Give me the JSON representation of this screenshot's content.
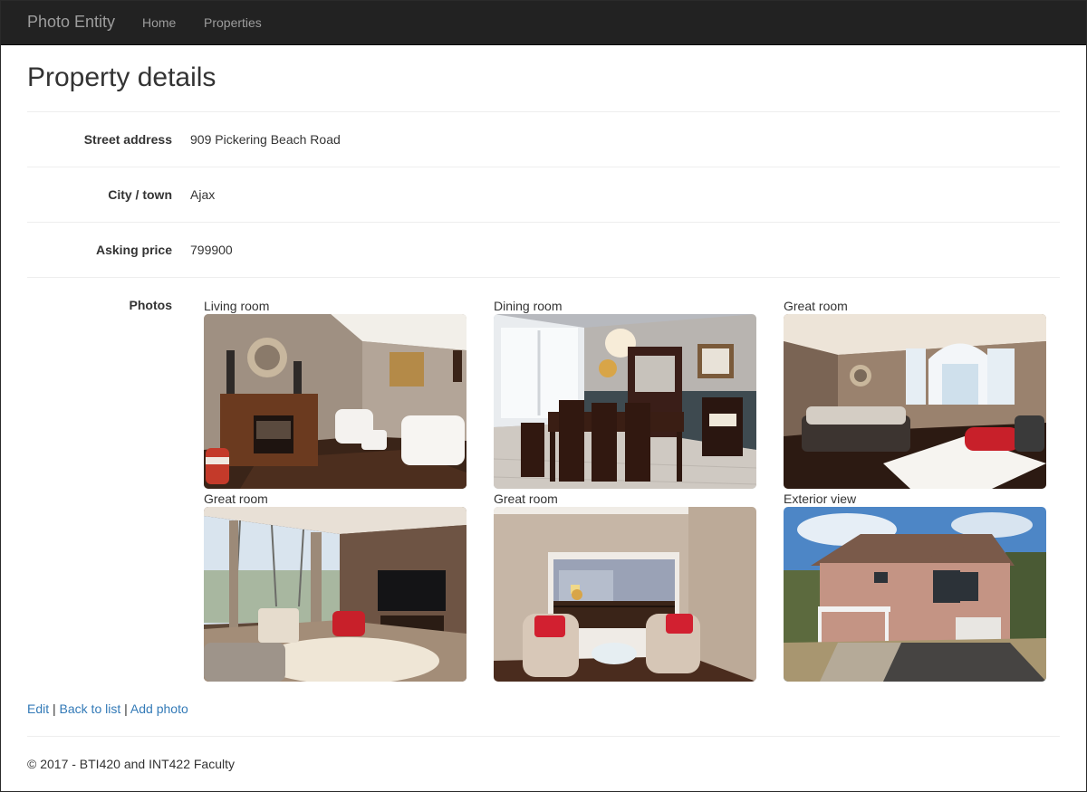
{
  "navbar": {
    "brand": "Photo Entity",
    "links": [
      "Home",
      "Properties"
    ]
  },
  "page": {
    "title": "Property details"
  },
  "details": [
    {
      "label": "Street address",
      "value": "909 Pickering Beach Road"
    },
    {
      "label": "City / town",
      "value": "Ajax"
    },
    {
      "label": "Asking price",
      "value": "799900"
    }
  ],
  "photos": {
    "label": "Photos",
    "items": [
      {
        "caption": "Living room",
        "icon": "living-room-photo"
      },
      {
        "caption": "Dining room",
        "icon": "dining-room-photo"
      },
      {
        "caption": "Great room",
        "icon": "great-room-photo"
      },
      {
        "caption": "Great room",
        "icon": "great-room-photo"
      },
      {
        "caption": "Great room",
        "icon": "great-room-photo"
      },
      {
        "caption": "Exterior view",
        "icon": "exterior-view-photo"
      }
    ]
  },
  "actions": {
    "edit": "Edit",
    "back": "Back to list",
    "add_photo": "Add photo",
    "separator": "|"
  },
  "footer": {
    "text": "© 2017 - BTI420 and INT422 Faculty"
  },
  "colors": {
    "navbar_bg": "#222222",
    "navbar_text": "#9d9d9d",
    "link": "#337ab7",
    "text": "#333333",
    "rule": "#eeeeee"
  }
}
